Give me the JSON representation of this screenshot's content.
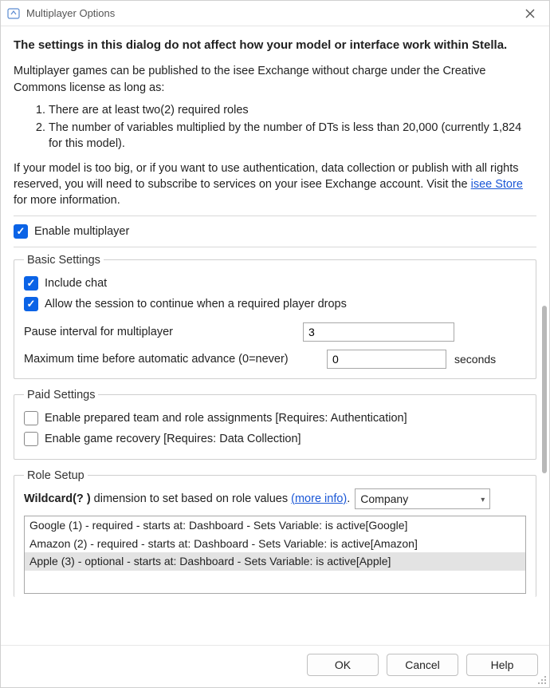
{
  "window": {
    "title": "Multiplayer Options"
  },
  "intro": {
    "bold": "The settings in this dialog do not affect how your model or interface work within Stella.",
    "p1": "Multiplayer games can be published to the isee Exchange without charge under the Creative Commons license as long as:",
    "li1": "There are at least two(2) required roles",
    "li2": "The number of variables multiplied by the number of DTs is less than 20,000 (currently 1,824 for this model).",
    "p2a": "If your model is too big, or if you want to use authentication, data collection or publish with all rights reserved, you will need to subscribe to services on your isee Exchange account. Visit the ",
    "p2_link": "isee Store",
    "p2b": " for more information."
  },
  "enable": {
    "label": "Enable multiplayer",
    "checked": true
  },
  "basic": {
    "legend": "Basic Settings",
    "include_chat_label": "Include chat",
    "include_chat_checked": true,
    "allow_continue_label": "Allow the session to continue when a required player drops",
    "allow_continue_checked": true,
    "pause_label": "Pause interval for multiplayer",
    "pause_value": "3",
    "maxtime_label": "Maximum time before automatic advance (0=never)",
    "maxtime_value": "0",
    "seconds_label": "seconds"
  },
  "paid": {
    "legend": "Paid Settings",
    "prepared_label": "Enable prepared team and role assignments [Requires: Authentication]",
    "prepared_checked": false,
    "recovery_label": "Enable game recovery [Requires: Data Collection]",
    "recovery_checked": false
  },
  "roles": {
    "legend": "Role Setup",
    "wildcard_bold": "Wildcard(? )",
    "wildcard_rest": " dimension to set based on role values ",
    "more_info": "(more info)",
    "period": ".",
    "select_value": "Company",
    "items": [
      "Google (1) - required - starts at: Dashboard - Sets Variable: is active[Google]",
      "Amazon (2) - required - starts at: Dashboard - Sets Variable: is active[Amazon]",
      "Apple (3) - optional - starts at: Dashboard - Sets Variable: is active[Apple]"
    ],
    "selected_index": 2
  },
  "buttons": {
    "ok": "OK",
    "cancel": "Cancel",
    "help": "Help"
  }
}
